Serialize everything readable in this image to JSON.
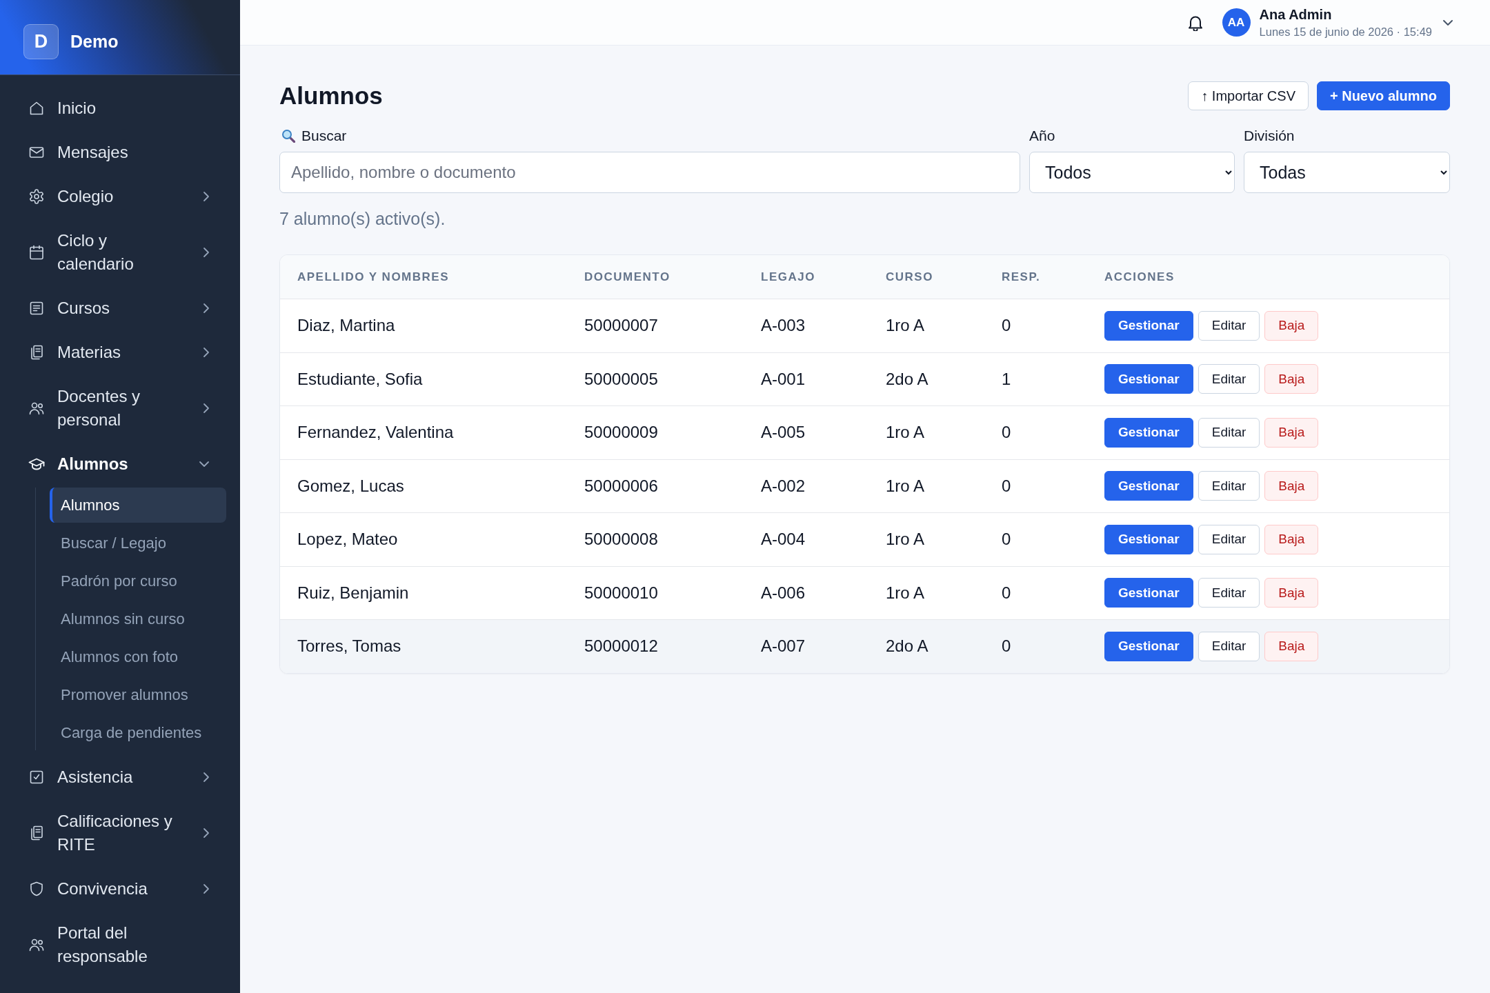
{
  "sidebar": {
    "logo": {
      "initial": "D",
      "name": "Demo"
    },
    "items": [
      {
        "label": "Inicio",
        "has_submenu": false,
        "expanded": false
      },
      {
        "label": "Mensajes",
        "has_submenu": false,
        "expanded": false
      },
      {
        "label": "Colegio",
        "has_submenu": true,
        "expanded": false
      },
      {
        "label": "Ciclo y calendario",
        "has_submenu": true,
        "expanded": false
      },
      {
        "label": "Cursos",
        "has_submenu": true,
        "expanded": false
      },
      {
        "label": "Materias",
        "has_submenu": true,
        "expanded": false
      },
      {
        "label": "Docentes y personal",
        "has_submenu": true,
        "expanded": false
      },
      {
        "label": "Alumnos",
        "has_submenu": true,
        "expanded": true,
        "children": [
          {
            "label": "Alumnos",
            "selected": true
          },
          {
            "label": "Buscar / Legajo",
            "selected": false
          },
          {
            "label": "Padrón por curso",
            "selected": false
          },
          {
            "label": "Alumnos sin curso",
            "selected": false
          },
          {
            "label": "Alumnos con foto",
            "selected": false
          },
          {
            "label": "Promover alumnos",
            "selected": false
          },
          {
            "label": "Carga de pendientes",
            "selected": false
          }
        ]
      },
      {
        "label": "Asistencia",
        "has_submenu": true,
        "expanded": false
      },
      {
        "label": "Calificaciones y RITE",
        "has_submenu": true,
        "expanded": false
      },
      {
        "label": "Convivencia",
        "has_submenu": true,
        "expanded": false
      },
      {
        "label": "Portal del responsable",
        "has_submenu": false,
        "expanded": false
      }
    ]
  },
  "topbar": {
    "user": {
      "initials": "AA",
      "name": "Ana Admin",
      "datetime": "Lunes 15 de junio de 2026 · 15:49"
    }
  },
  "page": {
    "title": "Alumnos",
    "actions": [
      {
        "label": "↑ Importar CSV",
        "kind": "secondary"
      },
      {
        "label": "+ Nuevo alumno",
        "kind": "primary"
      }
    ],
    "search": {
      "label": "Buscar",
      "placeholder": "Apellido, nombre o documento"
    },
    "filters": [
      {
        "label": "Año",
        "value": "Todos"
      },
      {
        "label": "División",
        "value": "Todas"
      }
    ],
    "summary": "7 alumno(s) activo(s).",
    "table": {
      "columns": [
        "APELLIDO Y NOMBRES",
        "DOCUMENTO",
        "LEGAJO",
        "CURSO",
        "RESP.",
        "ACCIONES"
      ],
      "rows": [
        {
          "cells": [
            "Diaz, Martina",
            "50000007",
            "A-003",
            "1ro A",
            "0"
          ],
          "highlighted": false,
          "actions": [
            {
              "label": "Gestionar",
              "kind": "primary"
            },
            {
              "label": "Editar",
              "kind": "secondary"
            },
            {
              "label": "Baja",
              "kind": "danger"
            }
          ]
        },
        {
          "cells": [
            "Estudiante, Sofia",
            "50000005",
            "A-001",
            "2do A",
            "1"
          ],
          "highlighted": false,
          "actions": [
            {
              "label": "Gestionar",
              "kind": "primary"
            },
            {
              "label": "Editar",
              "kind": "secondary"
            },
            {
              "label": "Baja",
              "kind": "danger"
            }
          ]
        },
        {
          "cells": [
            "Fernandez, Valentina",
            "50000009",
            "A-005",
            "1ro A",
            "0"
          ],
          "highlighted": false,
          "actions": [
            {
              "label": "Gestionar",
              "kind": "primary"
            },
            {
              "label": "Editar",
              "kind": "secondary"
            },
            {
              "label": "Baja",
              "kind": "danger"
            }
          ]
        },
        {
          "cells": [
            "Gomez, Lucas",
            "50000006",
            "A-002",
            "1ro A",
            "0"
          ],
          "highlighted": false,
          "actions": [
            {
              "label": "Gestionar",
              "kind": "primary"
            },
            {
              "label": "Editar",
              "kind": "secondary"
            },
            {
              "label": "Baja",
              "kind": "danger"
            }
          ]
        },
        {
          "cells": [
            "Lopez, Mateo",
            "50000008",
            "A-004",
            "1ro A",
            "0"
          ],
          "highlighted": false,
          "actions": [
            {
              "label": "Gestionar",
              "kind": "primary"
            },
            {
              "label": "Editar",
              "kind": "secondary"
            },
            {
              "label": "Baja",
              "kind": "danger"
            }
          ]
        },
        {
          "cells": [
            "Ruiz, Benjamin",
            "50000010",
            "A-006",
            "1ro A",
            "0"
          ],
          "highlighted": false,
          "actions": [
            {
              "label": "Gestionar",
              "kind": "primary"
            },
            {
              "label": "Editar",
              "kind": "secondary"
            },
            {
              "label": "Baja",
              "kind": "danger"
            }
          ]
        },
        {
          "cells": [
            "Torres, Tomas",
            "50000012",
            "A-007",
            "2do A",
            "0"
          ],
          "highlighted": true,
          "actions": [
            {
              "label": "Gestionar",
              "kind": "primary"
            },
            {
              "label": "Editar",
              "kind": "secondary"
            },
            {
              "label": "Baja",
              "kind": "danger"
            }
          ]
        }
      ]
    }
  }
}
